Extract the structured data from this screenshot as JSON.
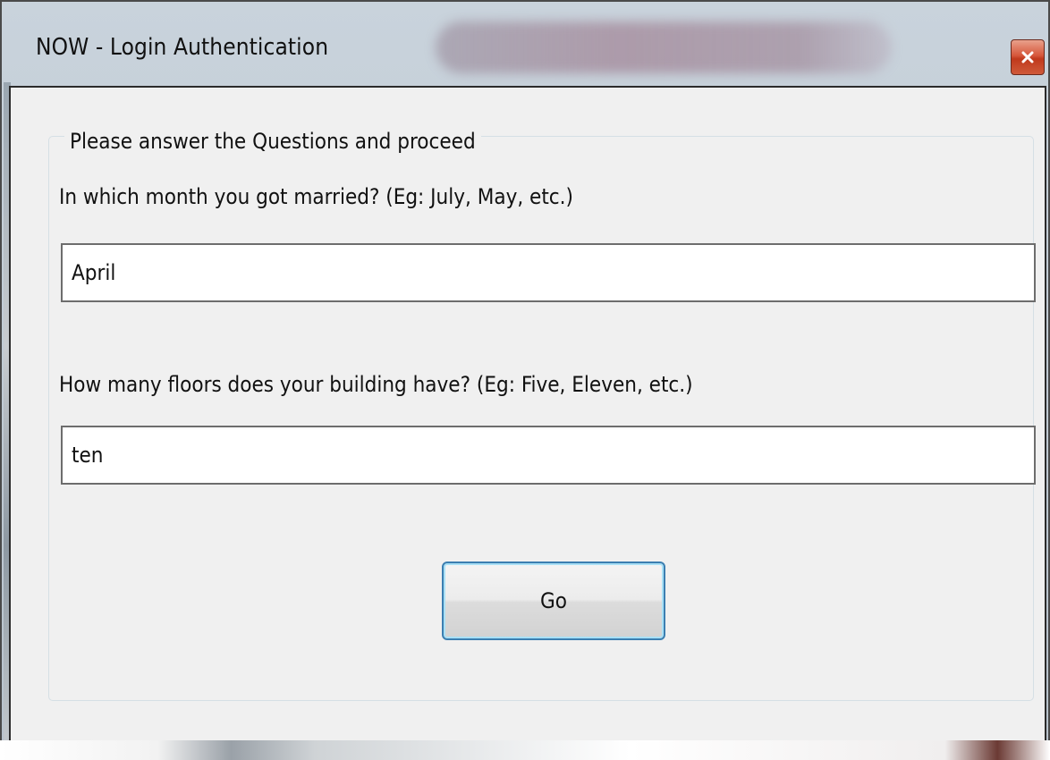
{
  "window": {
    "title": "NOW - Login Authentication",
    "close_icon": "close-icon"
  },
  "form": {
    "group_title": "Please answer the Questions and proceed",
    "question1": {
      "label": "In which month you got married? (Eg: July, May, etc.)",
      "value": "April"
    },
    "question2": {
      "label": "How many floors does your building have? (Eg: Five, Eleven, etc.)",
      "value": "ten"
    },
    "submit_label": "Go"
  },
  "colors": {
    "close_button": "#c7411f",
    "focus_border": "#3c7fb1",
    "dialog_background": "#f0f0f0"
  }
}
